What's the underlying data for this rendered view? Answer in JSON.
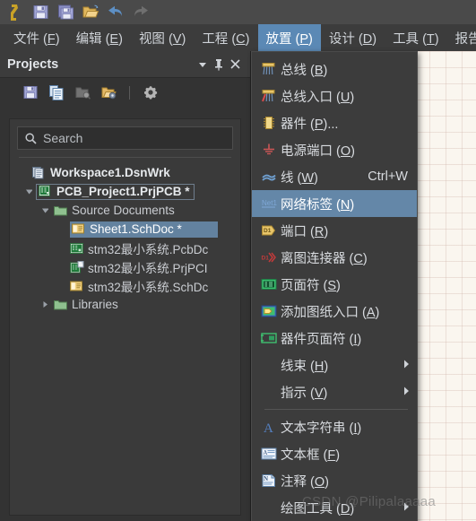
{
  "app": {
    "toolbar": [
      {
        "name": "altium-logo-icon",
        "label": "A"
      },
      {
        "name": "save-icon",
        "label": "Save"
      },
      {
        "name": "save-all-icon",
        "label": "Save All"
      },
      {
        "name": "open-project-icon",
        "label": "Open"
      },
      {
        "name": "undo-icon",
        "label": "Undo"
      },
      {
        "name": "redo-icon",
        "label": "Redo"
      }
    ]
  },
  "menubar": {
    "items": [
      {
        "text": "文件",
        "key": "F",
        "active": false
      },
      {
        "text": "编辑",
        "key": "E",
        "active": false
      },
      {
        "text": "视图",
        "key": "V",
        "active": false
      },
      {
        "text": "工程",
        "key": "C",
        "active": false
      },
      {
        "text": "放置",
        "key": "P",
        "active": true
      },
      {
        "text": "设计",
        "key": "D",
        "active": false
      },
      {
        "text": "工具",
        "key": "T",
        "active": false
      },
      {
        "text": "报告",
        "key": "",
        "active": false
      }
    ]
  },
  "panel": {
    "title": "Projects",
    "header_buttons": [
      {
        "name": "panel-dropdown-icon",
        "glyph": "▼"
      },
      {
        "name": "panel-pin-icon",
        "glyph": "⚲"
      },
      {
        "name": "panel-close-icon",
        "glyph": "✕"
      }
    ],
    "toolbar": [
      {
        "name": "save-project-icon"
      },
      {
        "name": "copy-document-icon"
      },
      {
        "name": "open-folder-search-icon"
      },
      {
        "name": "folder-options-icon"
      },
      {
        "name": "gear-icon"
      }
    ],
    "search": {
      "placeholder": "Search",
      "value": "",
      "icon": "search-icon"
    },
    "tree": [
      {
        "level": 0,
        "twisty": "",
        "icon": "workspace-icon",
        "label": "Workspace1.DsnWrk",
        "bold": true,
        "state": "none"
      },
      {
        "level": 1,
        "twisty": "▾",
        "icon": "pcb-project-icon",
        "label": "PCB_Project1.PrjPCB *",
        "bold": true,
        "state": "boxed"
      },
      {
        "level": 2,
        "twisty": "▾",
        "icon": "folder-icon",
        "label": "Source Documents",
        "bold": false,
        "state": "none"
      },
      {
        "level": 3,
        "twisty": "",
        "icon": "schdoc-icon",
        "label": "Sheet1.SchDoc *",
        "bold": false,
        "state": "selected"
      },
      {
        "level": 3,
        "twisty": "",
        "icon": "pcbdoc-icon",
        "label": "stm32最小系统.PcbDc",
        "bold": false,
        "state": "none"
      },
      {
        "level": 3,
        "twisty": "",
        "icon": "prjpcb-icon",
        "label": "stm32最小系统.PrjPCI",
        "bold": false,
        "state": "none"
      },
      {
        "level": 3,
        "twisty": "",
        "icon": "schdoc-icon",
        "label": "stm32最小系统.SchDc",
        "bold": false,
        "state": "none"
      },
      {
        "level": 2,
        "twisty": "▸",
        "icon": "folder-icon",
        "label": "Libraries",
        "bold": false,
        "state": "none"
      }
    ]
  },
  "place_menu": {
    "items": [
      {
        "type": "item",
        "icon": "bus-icon",
        "text": "总线",
        "key": "B",
        "suffix": "",
        "shortcut": "",
        "submenu": false,
        "highlighted": false
      },
      {
        "type": "item",
        "icon": "bus-entry-icon",
        "text": "总线入口",
        "key": "U",
        "suffix": "",
        "shortcut": "",
        "submenu": false,
        "highlighted": false
      },
      {
        "type": "item",
        "icon": "part-icon",
        "text": "器件",
        "key": "P",
        "suffix": "...",
        "shortcut": "",
        "submenu": false,
        "highlighted": false
      },
      {
        "type": "item",
        "icon": "power-port-icon",
        "text": "电源端口",
        "key": "O",
        "suffix": "",
        "shortcut": "",
        "submenu": false,
        "highlighted": false
      },
      {
        "type": "item",
        "icon": "wire-icon",
        "text": "线",
        "key": "W",
        "suffix": "",
        "shortcut": "Ctrl+W",
        "submenu": false,
        "highlighted": false
      },
      {
        "type": "item",
        "icon": "net-label-icon",
        "text": "网络标签",
        "key": "N",
        "suffix": "",
        "shortcut": "",
        "submenu": false,
        "highlighted": true
      },
      {
        "type": "item",
        "icon": "port-icon",
        "text": "端口",
        "key": "R",
        "suffix": "",
        "shortcut": "",
        "submenu": false,
        "highlighted": false
      },
      {
        "type": "item",
        "icon": "off-sheet-conn-icon",
        "text": "离图连接器",
        "key": "C",
        "suffix": "",
        "shortcut": "",
        "submenu": false,
        "highlighted": false
      },
      {
        "type": "item",
        "icon": "sheet-symbol-icon",
        "text": "页面符",
        "key": "S",
        "suffix": "",
        "shortcut": "",
        "submenu": false,
        "highlighted": false
      },
      {
        "type": "item",
        "icon": "sheet-entry-icon",
        "text": "添加图纸入口",
        "key": "A",
        "suffix": "",
        "shortcut": "",
        "submenu": false,
        "highlighted": false
      },
      {
        "type": "item",
        "icon": "device-sheet-icon",
        "text": "器件页面符",
        "key": "I",
        "suffix": "",
        "shortcut": "",
        "submenu": false,
        "highlighted": false
      },
      {
        "type": "item",
        "icon": "none",
        "text": "线束",
        "key": "H",
        "suffix": "",
        "shortcut": "",
        "submenu": true,
        "highlighted": false
      },
      {
        "type": "item",
        "icon": "none",
        "text": "指示",
        "key": "V",
        "suffix": "",
        "shortcut": "",
        "submenu": true,
        "highlighted": false
      },
      {
        "type": "separator"
      },
      {
        "type": "item",
        "icon": "text-string-icon",
        "text": "文本字符串",
        "key": "I",
        "suffix": "",
        "shortcut": "",
        "submenu": false,
        "highlighted": false
      },
      {
        "type": "item",
        "icon": "text-frame-icon",
        "text": "文本框",
        "key": "F",
        "suffix": "",
        "shortcut": "",
        "submenu": false,
        "highlighted": false
      },
      {
        "type": "item",
        "icon": "note-icon",
        "text": "注释",
        "key": "O",
        "suffix": "",
        "shortcut": "",
        "submenu": false,
        "highlighted": false
      },
      {
        "type": "item",
        "icon": "none",
        "text": "绘图工具",
        "key": "D",
        "suffix": "",
        "shortcut": "",
        "submenu": true,
        "highlighted": false
      }
    ]
  },
  "watermark": {
    "text": "CSDN @Pilipalaaaaa"
  },
  "colors": {
    "menu_bg": "#3c3c3c",
    "panel_bg": "#333333",
    "highlight": "#6487a8",
    "selection": "#63829f",
    "text": "#d8dbdf",
    "canvas": "#faf6ef"
  }
}
